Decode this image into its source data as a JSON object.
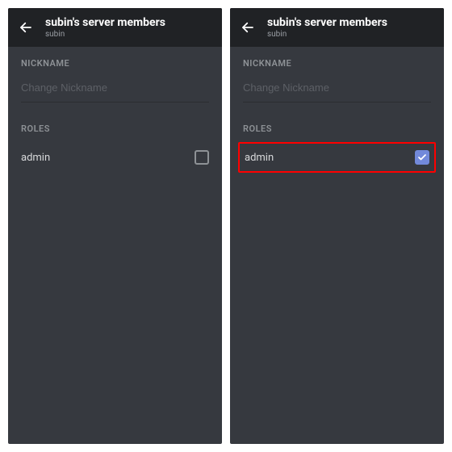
{
  "left": {
    "header": {
      "title": "subin's server members",
      "subtitle": "subin"
    },
    "nickname": {
      "label": "NICKNAME",
      "placeholder": "Change Nickname",
      "value": ""
    },
    "roles": {
      "label": "ROLES",
      "items": [
        {
          "name": "admin",
          "checked": false
        }
      ]
    }
  },
  "right": {
    "header": {
      "title": "subin's server members",
      "subtitle": "subin"
    },
    "nickname": {
      "label": "NICKNAME",
      "placeholder": "Change Nickname",
      "value": ""
    },
    "roles": {
      "label": "ROLES",
      "items": [
        {
          "name": "admin",
          "checked": true,
          "highlighted": true
        }
      ]
    }
  },
  "colors": {
    "bg": "#36393f",
    "headerBg": "#202225",
    "accent": "#7289da",
    "highlight": "#ff0000"
  }
}
